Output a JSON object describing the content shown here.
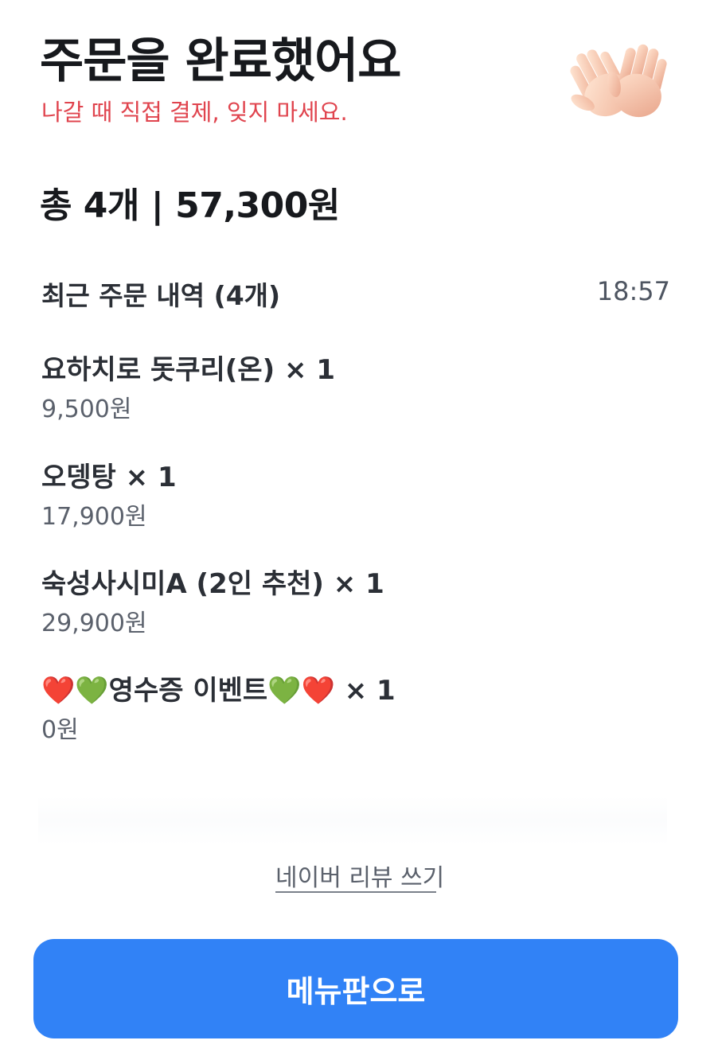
{
  "header": {
    "title": "주문을 완료했어요",
    "subtitle": "나갈 때 직접 결제, 잊지 마세요.",
    "illustration": "clapping-hands-icon"
  },
  "summary": {
    "text": "총 4개 | 57,300원"
  },
  "history": {
    "title": "최근 주문 내역 (4개)",
    "time": "18:57"
  },
  "items": [
    {
      "name": "요하치로 돗쿠리(온) × 1",
      "price": "9,500원"
    },
    {
      "name": "오뎅탕 × 1",
      "price": "17,900원"
    },
    {
      "name": "숙성사시미A (2인 추천) × 1",
      "price": "29,900원"
    },
    {
      "name": "❤️💚영수증 이벤트💚❤️ × 1",
      "price": "0원"
    }
  ],
  "actions": {
    "review_link": "네이버 리뷰 쓰기",
    "menu_button": "메뉴판으로"
  },
  "colors": {
    "accent": "#3182f6",
    "warning_text": "#e0444e"
  }
}
